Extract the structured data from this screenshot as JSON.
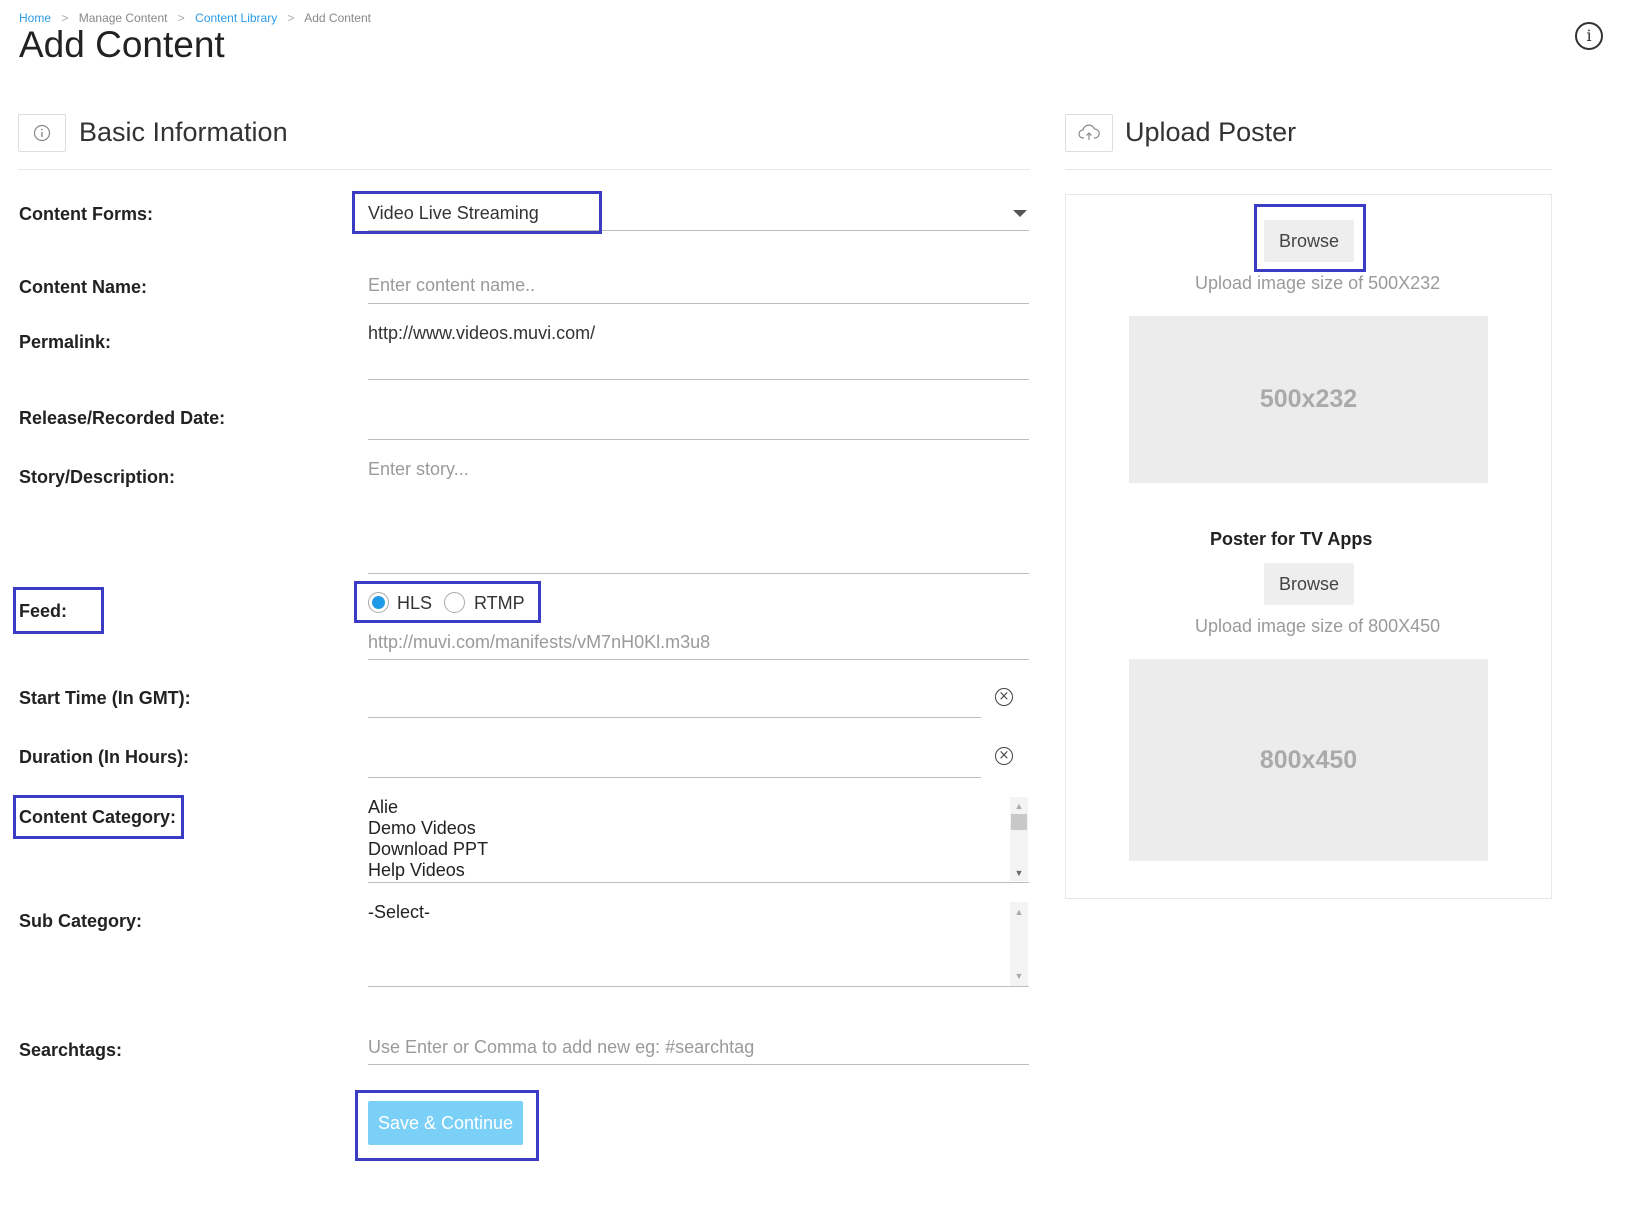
{
  "breadcrumb": {
    "items": [
      {
        "label": "Home"
      },
      {
        "label": "Manage Content"
      },
      {
        "label": "Content Library"
      },
      {
        "label": "Add Content"
      }
    ],
    "separator": ">"
  },
  "page": {
    "title": "Add Content"
  },
  "basic_info": {
    "title": "Basic Information",
    "fields": {
      "content_forms": {
        "label": "Content Forms:",
        "value": "Video Live Streaming"
      },
      "content_name": {
        "label": "Content Name:",
        "placeholder": "Enter content name.."
      },
      "permalink": {
        "label": "Permalink:",
        "value": "http://www.videos.muvi.com/"
      },
      "release_date": {
        "label": "Release/Recorded Date:"
      },
      "story": {
        "label": "Story/Description:",
        "placeholder": "Enter story..."
      },
      "feed": {
        "label": "Feed:",
        "options": [
          {
            "label": "HLS",
            "selected": true
          },
          {
            "label": "RTMP",
            "selected": false
          }
        ],
        "url_placeholder": "http://muvi.com/manifests/vM7nH0Kl.m3u8"
      },
      "start_time": {
        "label": "Start Time (In GMT):"
      },
      "duration": {
        "label": "Duration (In Hours):"
      },
      "content_category": {
        "label": "Content Category:",
        "items": [
          "Alie",
          "Demo Videos",
          "Download PPT",
          "Help Videos"
        ]
      },
      "sub_category": {
        "label": "Sub Category:",
        "items": [
          "-Select-"
        ]
      },
      "searchtags": {
        "label": "Searchtags:",
        "placeholder": "Use Enter or Comma to add new eg: #searchtag"
      }
    },
    "save_button": "Save & Continue"
  },
  "upload_poster": {
    "title": "Upload Poster",
    "browse_label": "Browse",
    "hint_1": "Upload image size of 500X232",
    "placeholder_1": "500x232",
    "tv_title": "Poster for TV Apps",
    "browse_label_2": "Browse",
    "hint_2": "Upload image size of 800X450",
    "placeholder_2": "800x450"
  },
  "icons": {
    "help": "info-icon",
    "section_basic": "info-icon",
    "section_upload": "cloud-upload-icon",
    "dropdown": "caret-down-icon",
    "clear": "clear-circle-icon"
  },
  "colors": {
    "link": "#2b9be8",
    "radio_selected": "#1f9ae8",
    "save_button": "#7bd0f7",
    "highlight": "#3b3cc4",
    "placeholder_bg": "#ececec"
  }
}
